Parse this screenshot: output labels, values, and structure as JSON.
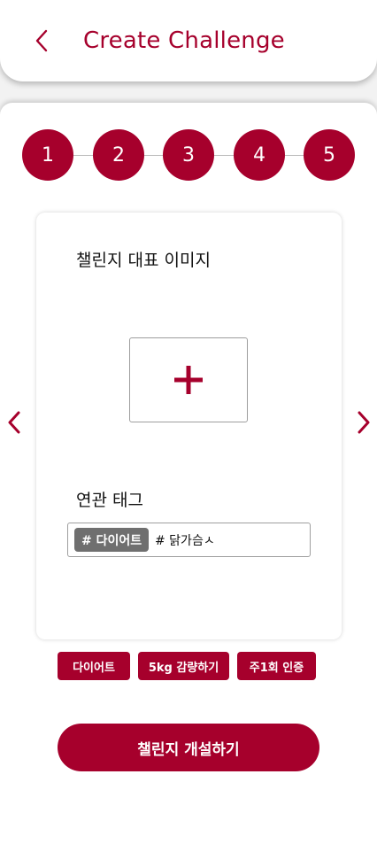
{
  "header": {
    "title": "Create Challenge",
    "back_icon": "chevron-left-icon"
  },
  "steps": [
    "1",
    "2",
    "3",
    "4",
    "5"
  ],
  "card": {
    "image_label": "챌린지 대표 이미지",
    "add_image_icon": "plus-icon",
    "tags_label": "연관 태그",
    "tag_chip": "# 다이어트",
    "tag_typing": "# 닭가슴ㅅ"
  },
  "nav": {
    "prev_icon": "chevron-left-icon",
    "next_icon": "chevron-right-icon"
  },
  "suggested_tags": [
    "다이어트",
    "5kg 감량하기",
    "주1회 인증"
  ],
  "submit_label": "챌린지 개설하기",
  "colors": {
    "accent": "#a6002c",
    "chip": "#6f6f6f",
    "background": "#f2f2f2"
  }
}
